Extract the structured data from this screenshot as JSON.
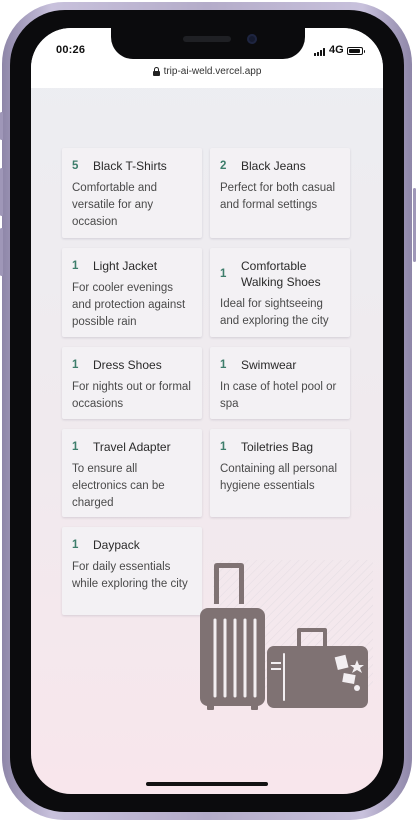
{
  "status_bar": {
    "time": "00:26",
    "network": "4G"
  },
  "browser": {
    "url": "trip-ai-weld.vercel.app"
  },
  "items": [
    {
      "qty": "5",
      "name": "Black T-Shirts",
      "desc": "Comfortable and versatile for any occasion"
    },
    {
      "qty": "2",
      "name": "Black Jeans",
      "desc": "Perfect for both casual and formal settings"
    },
    {
      "qty": "1",
      "name": "Light Jacket",
      "desc": "For cooler evenings and protection against possible rain"
    },
    {
      "qty": "1",
      "name": "Comfortable Walking Shoes",
      "desc": "Ideal for sightseeing and exploring the city"
    },
    {
      "qty": "1",
      "name": "Dress Shoes",
      "desc": "For nights out or formal occasions"
    },
    {
      "qty": "1",
      "name": "Swimwear",
      "desc": "In case of hotel pool or spa"
    },
    {
      "qty": "1",
      "name": "Travel Adapter",
      "desc": "To ensure all electronics can be charged"
    },
    {
      "qty": "1",
      "name": "Toiletries Bag",
      "desc": "Containing all personal hygiene essentials"
    },
    {
      "qty": "1",
      "name": "Daypack",
      "desc": "For daily essentials while exploring the city"
    }
  ],
  "illustration": {
    "icon": "luggage-icon",
    "color": "#7f7273"
  },
  "colors": {
    "quantity": "#3d7d6b",
    "phone_frame": "#b4acc9"
  }
}
